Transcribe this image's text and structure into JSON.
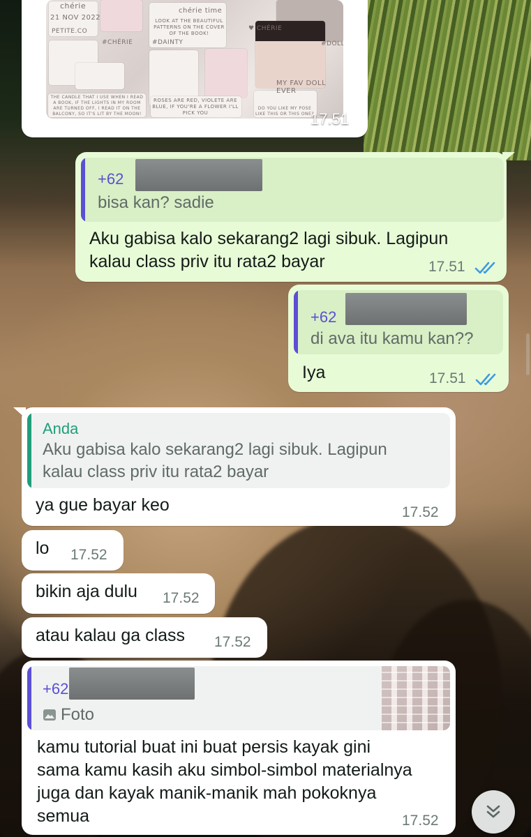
{
  "messages": {
    "image_msg": {
      "time": "17.51",
      "collage_labels": [
        "chérie",
        "21 NOV 2022",
        "PETITE.CO",
        "chérie time",
        "LOOK AT THE BEAUTIFUL PATTERNS ON THE COVER OF THE BOOK!",
        "#CHÉRIE",
        "#DAINTY",
        "♥ CHÉRIE",
        "#DOLL",
        "MY FAV DOLL EVER",
        "ROSES ARE RED, VIOLETE ARE BLUE, IF YOU'RE A FLOWER I'LL PICK YOU",
        "THE CANDLE THAT I USE WHEN I READ A BOOK, IF THE LIGHTS IN MY ROOM ARE TURNED OFF, I READ IT ON THE BALCONY, SO IT'S LIT BY THE MOON!",
        "DO YOU LIKE MY POSE LIKE THIS OR THIS ONE?"
      ]
    },
    "out1": {
      "quote_sender": "+62",
      "quote_text": "bisa kan? sadie",
      "text_line1": "Aku gabisa kalo sekarang2 lagi sibuk. Lagipun",
      "text_line2": "kalau class priv itu rata2 bayar",
      "time": "17.51"
    },
    "out2": {
      "quote_sender": "+62",
      "quote_text": "di ava itu kamu kan??",
      "text": "Iya",
      "time": "17.51"
    },
    "in1": {
      "quote_sender": "Anda",
      "quote_line1": "Aku gabisa kalo sekarang2 lagi sibuk. Lagipun",
      "quote_line2": "kalau class priv itu rata2 bayar",
      "text": "ya gue bayar keo",
      "time": "17.52"
    },
    "in2": {
      "text": "lo",
      "time": "17.52"
    },
    "in3": {
      "text": "bikin aja dulu",
      "time": "17.52"
    },
    "in4": {
      "text": "atau kalau ga class",
      "time": "17.52"
    },
    "in5": {
      "quote_sender": "+62",
      "quote_media_icon": "image-icon",
      "quote_media_label": "Foto",
      "line1": "kamu tutorial buat ini buat persis kayak gini",
      "line2": "sama kamu kasih aku simbol-simbol materialnya",
      "line3": "juga dan kayak manik-manik mah pokoknya",
      "line4": "semua",
      "time": "17.52"
    }
  },
  "colors": {
    "incoming_bubble": "#ffffff",
    "outgoing_bubble": "#e8fbd7",
    "quote_bar_contact": "#5b4fd4",
    "quote_bar_self": "#1f9e7a",
    "read_ticks": "#3d9be0"
  },
  "scroll_down_button": {
    "icon": "double-chevron-down-icon"
  }
}
